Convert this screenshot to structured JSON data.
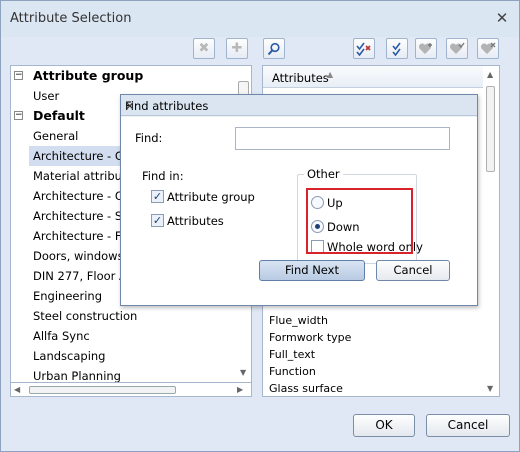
{
  "window": {
    "title": "Attribute Selection"
  },
  "tree": [
    {
      "label": "Attribute group",
      "bold": true,
      "toggle": "−"
    },
    {
      "label": "User",
      "bold": false,
      "toggle": ""
    },
    {
      "label": "Default",
      "bold": true,
      "toggle": "−"
    },
    {
      "label": "General",
      "bold": false,
      "toggle": ""
    },
    {
      "label": "Architecture - G",
      "bold": false,
      "toggle": "",
      "selected": true
    },
    {
      "label": "Material attribute",
      "bold": false,
      "toggle": ""
    },
    {
      "label": "Architecture - Q",
      "bold": false,
      "toggle": ""
    },
    {
      "label": "Architecture - S",
      "bold": false,
      "toggle": ""
    },
    {
      "label": "Architecture -  F",
      "bold": false,
      "toggle": ""
    },
    {
      "label": "Doors, windows",
      "bold": false,
      "toggle": ""
    },
    {
      "label": "DIN 277, Floor A",
      "bold": false,
      "toggle": ""
    },
    {
      "label": "Engineering",
      "bold": false,
      "toggle": ""
    },
    {
      "label": "Steel construction",
      "bold": false,
      "toggle": ""
    },
    {
      "label": "Allfa Sync",
      "bold": false,
      "toggle": ""
    },
    {
      "label": "Landscaping",
      "bold": false,
      "toggle": ""
    },
    {
      "label": "Urban Planning",
      "bold": false,
      "toggle": ""
    }
  ],
  "attributes": {
    "header": "Attributes",
    "rows": [
      "Flue_width",
      "Formwork type",
      "Full_text",
      "Function",
      "Glass surface"
    ]
  },
  "buttons": {
    "ok": "OK",
    "cancel": "Cancel"
  },
  "find_dialog": {
    "title": "Find attributes",
    "find_label": "Find:",
    "find_value": "",
    "find_in_label": "Find in:",
    "attribute_group_label": "Attribute group",
    "attribute_group_checked": true,
    "attributes_label": "Attributes",
    "attributes_checked": true,
    "other_label": "Other",
    "up_label": "Up",
    "down_label": "Down",
    "direction": "Down",
    "whole_word_label": "Whole word only",
    "whole_word_checked": false,
    "find_next": "Find Next",
    "cancel": "Cancel"
  },
  "icons": [
    "delete-icon",
    "add-icon",
    "search-icon",
    "uncheck-all-icon",
    "check-all-icon",
    "heart-add-icon",
    "heart-check-icon",
    "heart-remove-icon"
  ],
  "colors": {
    "highlight": "#d9232c",
    "selection": "#d2def0"
  }
}
